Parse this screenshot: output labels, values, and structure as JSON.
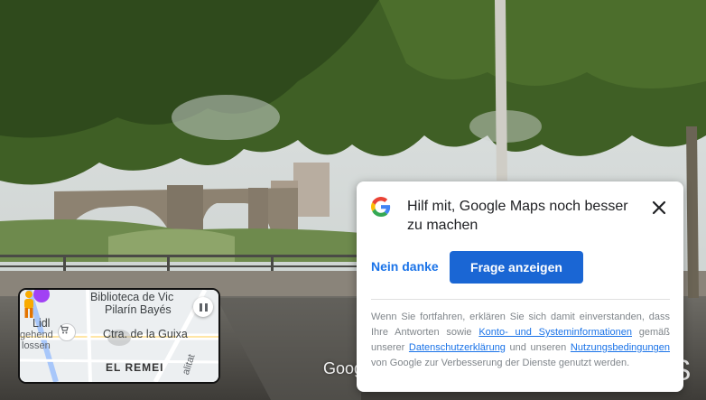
{
  "street_view": {
    "watermark": "Goog",
    "watermark_right": "S"
  },
  "minimap": {
    "labels": {
      "biblioteca_line1": "Biblioteca de Vic",
      "biblioteca_line2": "Pilarín Bayés",
      "lidl": "Lidl",
      "gehend": "gehend",
      "lossen": "lossen",
      "street_main": "Ctra. de la Guixa",
      "district": "EL REMEI",
      "side_street": "alitat"
    },
    "icons": [
      "pause-icon",
      "shopping-cart-icon",
      "pegman-icon"
    ]
  },
  "survey_card": {
    "title": "Hilf mit, Google Maps noch besser zu machen",
    "dismiss_label": "Nein danke",
    "primary_label": "Frage anzeigen",
    "disclaimer": {
      "part1": "Wenn Sie fortfahren, erklären Sie sich damit einverstanden, dass Ihre Antworten sowie ",
      "link1": "Konto- und Systeminformationen",
      "part2": " gemäß unserer ",
      "link2": "Datenschutzerklärung",
      "part3": " und unseren ",
      "link3": "Nutzungsbedingungen",
      "part4": " von Google zur Verbesserung der Dienste genutzt werden."
    },
    "colors": {
      "primary": "#1a66d4",
      "link": "#1a73e8"
    }
  }
}
